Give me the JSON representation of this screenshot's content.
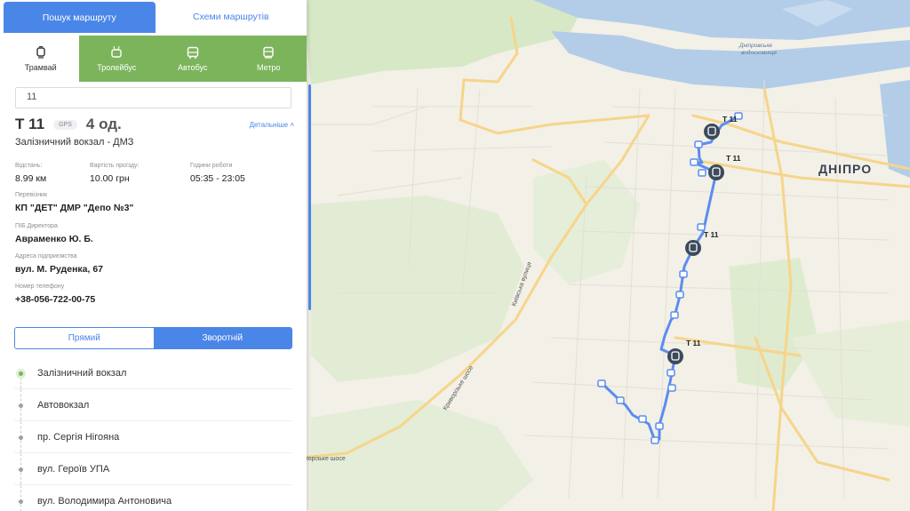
{
  "header_tabs": {
    "search": "Пошук маршруту",
    "schemes": "Схеми маршрутів"
  },
  "modes": [
    {
      "label": "Трамвай",
      "icon": "tram-icon"
    },
    {
      "label": "Тролейбус",
      "icon": "trolleybus-icon"
    },
    {
      "label": "Автобус",
      "icon": "bus-icon"
    },
    {
      "label": "Метро",
      "icon": "metro-icon"
    }
  ],
  "search": {
    "value": "11"
  },
  "route": {
    "number": "Т 11",
    "gps": "GPS",
    "units": "4 од.",
    "details_link": "Детальніше",
    "name": "Залізничний вокзал - ДМЗ"
  },
  "info": {
    "distance_label": "Відстань:",
    "distance": "8.99 км",
    "fare_label": "Вартість проїзду:",
    "fare": "10.00 грн",
    "hours_label": "Години роботи",
    "hours": "05:35 - 23:05",
    "carrier_label": "Перевізник",
    "carrier": "КП \"ДЕТ\" ДМР \"Депо №3\"",
    "director_label": "ПІБ Директора",
    "director": "Авраменко Ю. Б.",
    "address_label": "Адреса підприємства",
    "address": "вул. М. Руденка, 67",
    "phone_label": "Номер телефону",
    "phone": "+38-056-722-00-75"
  },
  "direction": {
    "forward": "Прямий",
    "reverse": "Зворотній"
  },
  "stops": [
    "Залізничний вокзал",
    "Автовокзал",
    "пр. Сергія Нігояна",
    "вул. Героїв УПА",
    "вул. Володимира Антоновича"
  ],
  "map": {
    "city_label": "ДНІПРО",
    "reservoir_label_1": "Дніпровське",
    "reservoir_label_2": "водосховище",
    "road_kyivska": "Київська вулиця",
    "road_kryvorizke": "Криворізьке шосе",
    "road_kryvorizke_2": "ворізьке шосе",
    "vehicle_label": "Т 11",
    "route_color": "#5b8def",
    "water_color": "#b3cde8"
  }
}
